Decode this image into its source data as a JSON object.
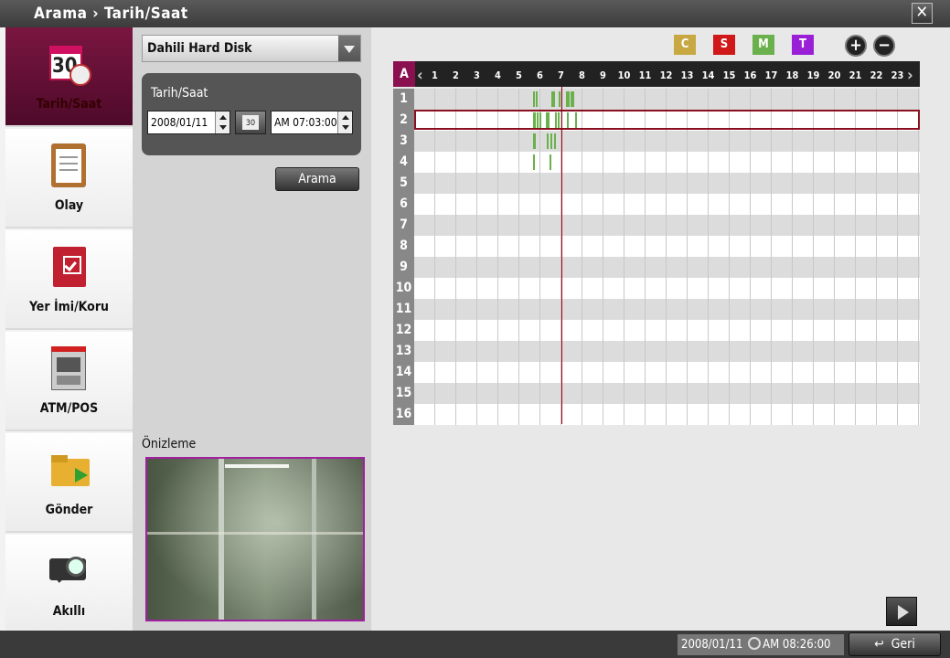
{
  "title": "Arama › Tarih/Saat",
  "nav": {
    "items": [
      {
        "label": "Tarih/Saat"
      },
      {
        "label": "Olay"
      },
      {
        "label": "Yer İmi/Koru"
      },
      {
        "label": "ATM/POS"
      },
      {
        "label": "Gönder"
      },
      {
        "label": "Akıllı"
      }
    ],
    "calendar_day": "30"
  },
  "source": {
    "selected": "Dahili Hard Disk"
  },
  "datetime": {
    "heading": "Tarih/Saat",
    "date": "2008/01/11",
    "time": "AM 07:03:00",
    "calendar_icon_text": "30"
  },
  "search_button": "Arama",
  "preview": {
    "label": "Önizleme"
  },
  "legend": [
    {
      "letter": "C",
      "color": "#c8a842"
    },
    {
      "letter": "S",
      "color": "#d01818"
    },
    {
      "letter": "M",
      "color": "#6ab04c"
    },
    {
      "letter": "T",
      "color": "#9a20d8"
    }
  ],
  "zoom": {
    "in": "+",
    "out": "−"
  },
  "grid": {
    "corner": "A",
    "hours": [
      "1",
      "2",
      "3",
      "4",
      "5",
      "6",
      "7",
      "8",
      "9",
      "10",
      "11",
      "12",
      "13",
      "14",
      "15",
      "16",
      "17",
      "18",
      "19",
      "20",
      "21",
      "22",
      "23"
    ],
    "channels": [
      "1",
      "2",
      "3",
      "4",
      "5",
      "6",
      "7",
      "8",
      "9",
      "10",
      "11",
      "12",
      "13",
      "14",
      "15",
      "16"
    ],
    "selected_channel": "2",
    "recording_color": "#6ab04c",
    "recordings": {
      "1": [
        5.72,
        5.85,
        6.6,
        6.7,
        6.95,
        7.3,
        7.4,
        7.5,
        7.6
      ],
      "2": [
        5.72,
        5.8,
        5.9,
        6.05,
        6.35,
        6.45,
        6.8,
        6.9,
        7.35,
        7.75
      ],
      "3": [
        5.72,
        5.8,
        6.4,
        6.55,
        6.75
      ],
      "4": [
        5.72,
        6.5
      ]
    },
    "cursor_time": "07:03"
  },
  "status": {
    "datetime": "2008/01/11",
    "time": "AM 08:26:00",
    "back": "Geri"
  }
}
